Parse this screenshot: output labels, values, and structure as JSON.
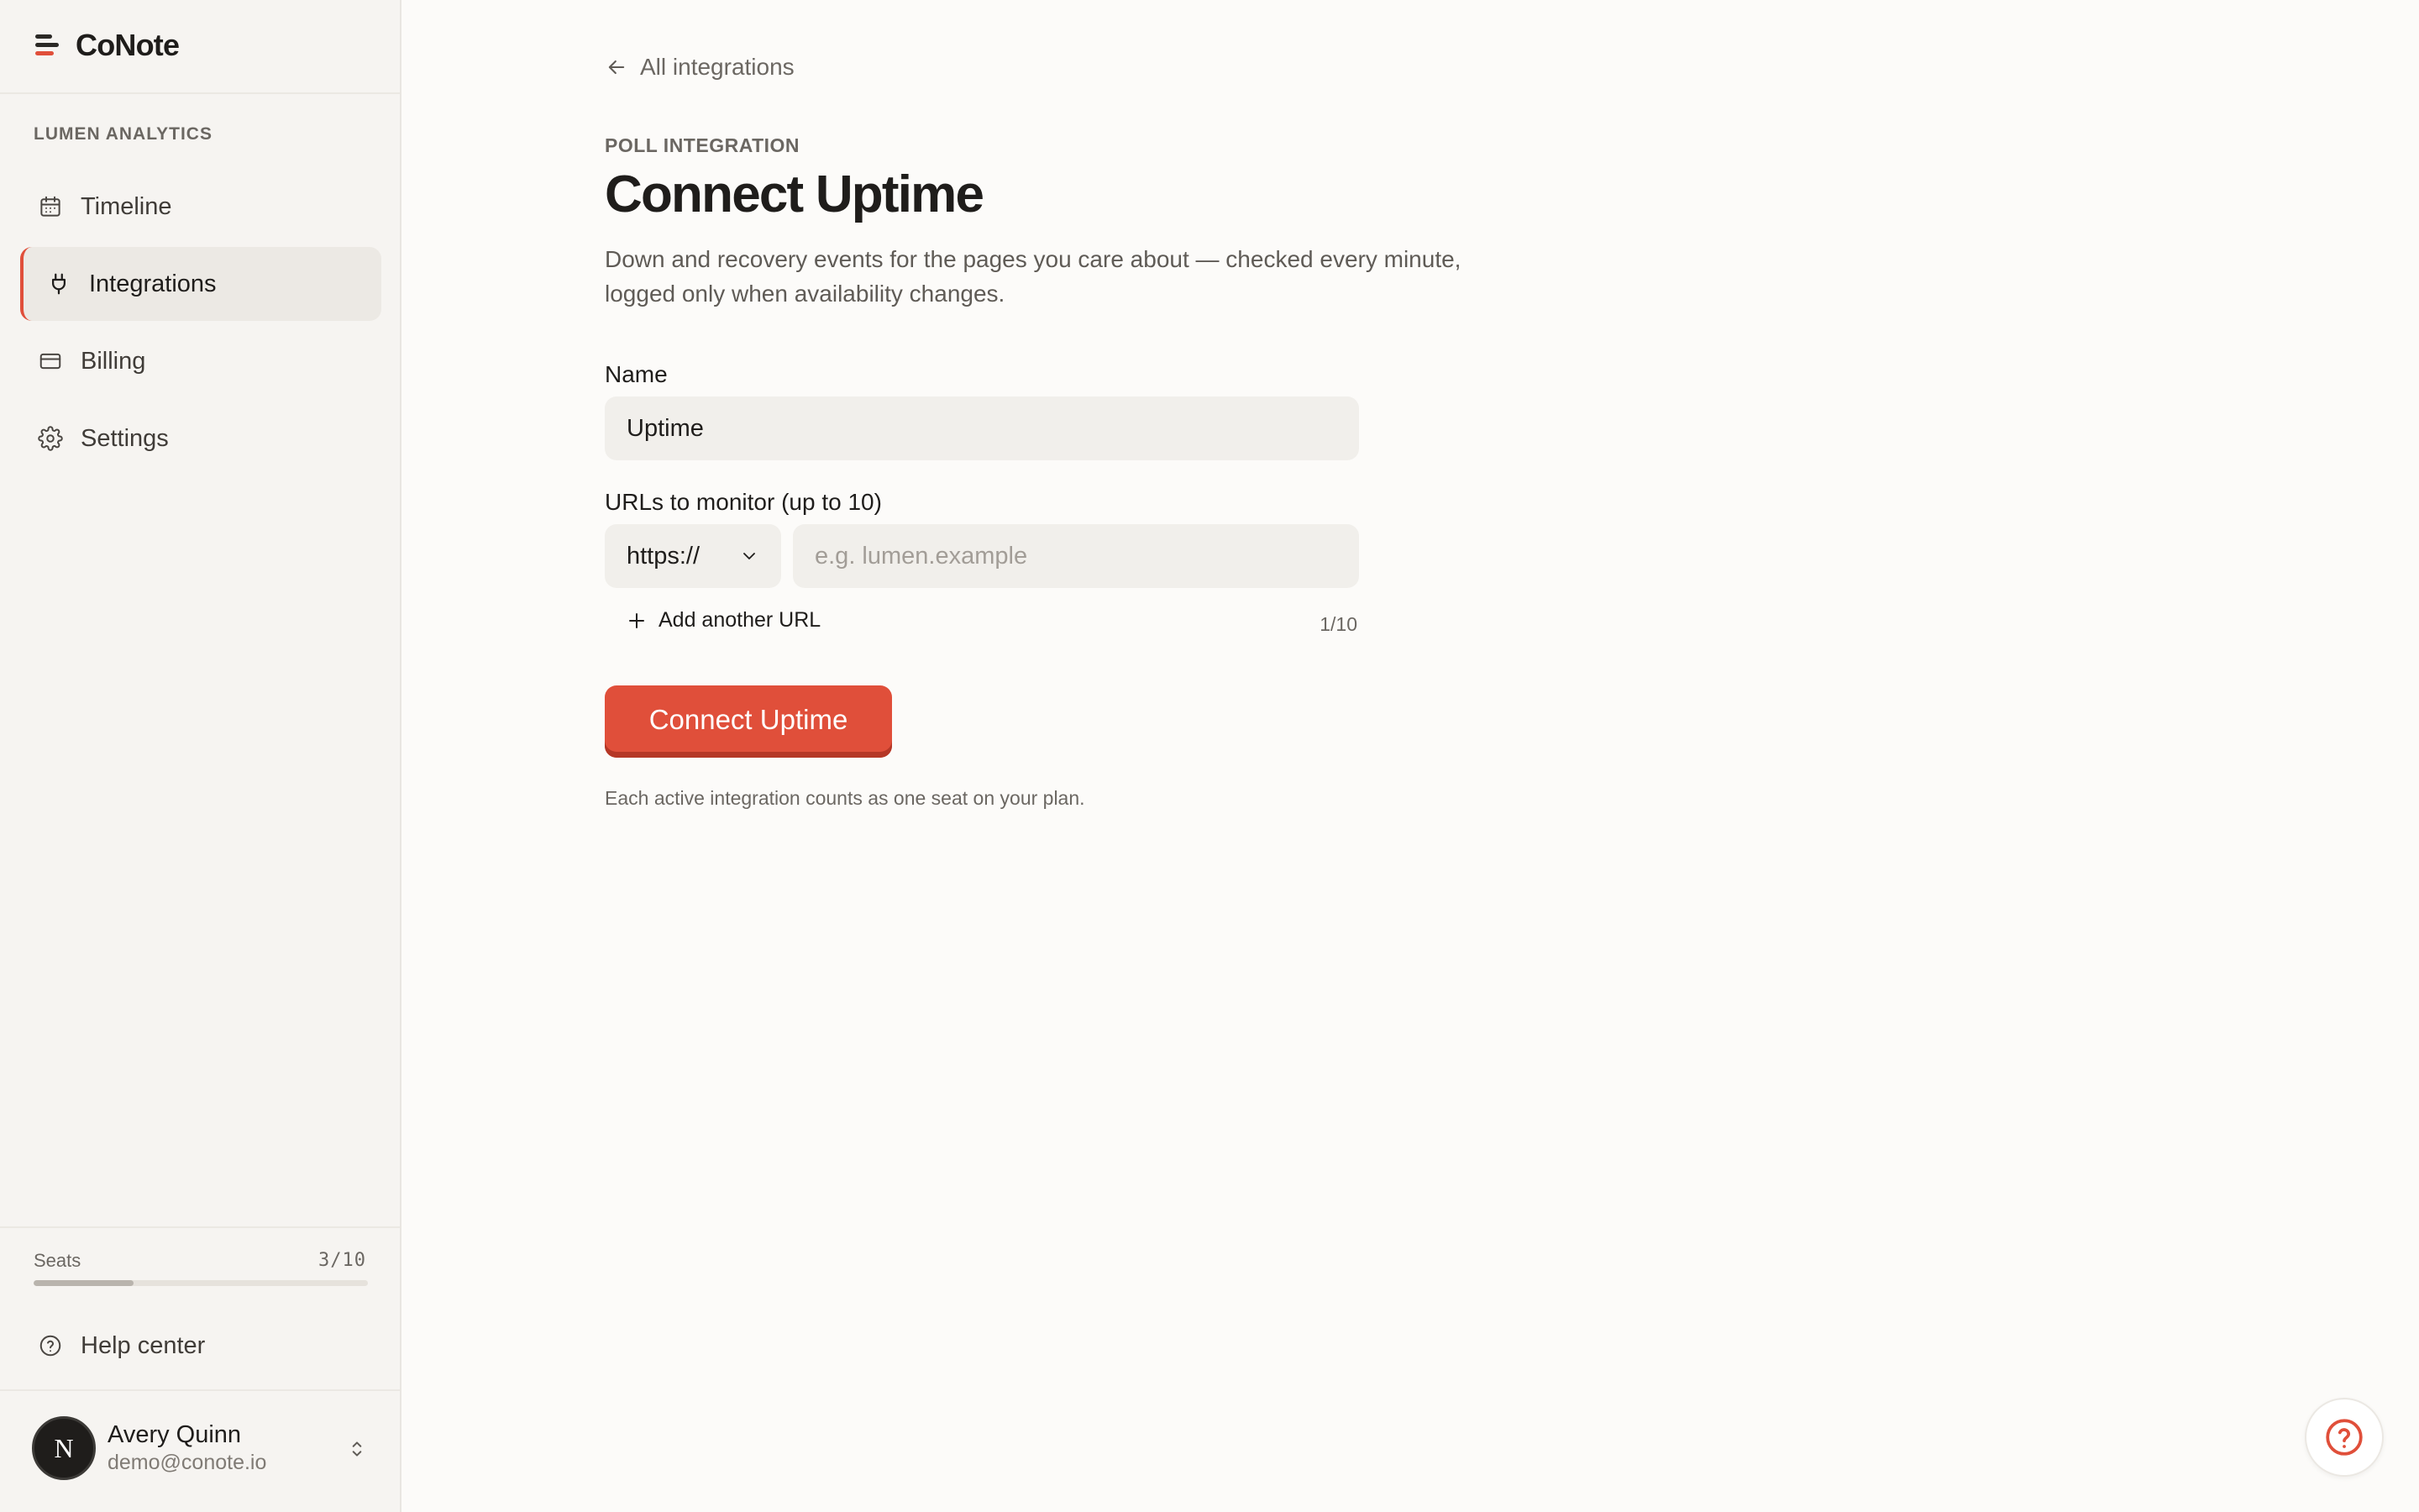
{
  "app": {
    "name": "CoNote",
    "accent_color": "#e04f3a"
  },
  "sidebar": {
    "workspace": "LUMEN ANALYTICS",
    "items": [
      {
        "label": "Timeline",
        "icon": "calendar-icon"
      },
      {
        "label": "Integrations",
        "icon": "plug-icon",
        "active": true
      },
      {
        "label": "Billing",
        "icon": "credit-card-icon"
      },
      {
        "label": "Settings",
        "icon": "gear-icon"
      }
    ],
    "seats": {
      "label": "Seats",
      "count": "3/10",
      "used_fraction": 0.3
    },
    "help": {
      "label": "Help center",
      "icon": "help-circle-icon"
    },
    "user": {
      "initial": "N",
      "name": "Avery Quinn",
      "email": "demo@conote.io"
    }
  },
  "main": {
    "back_label": "All integrations",
    "eyebrow": "POLL INTEGRATION",
    "title": "Connect Uptime",
    "description": "Down and recovery events for the pages you care about — checked every minute, logged only when availability changes.",
    "name_field": {
      "label": "Name",
      "value": "Uptime"
    },
    "urls_field": {
      "label": "URLs to monitor (up to 10)",
      "protocol": "https://",
      "placeholder": "e.g. lumen.example",
      "add_label": "Add another URL",
      "count": "1/10"
    },
    "submit_label": "Connect Uptime",
    "seat_note": "Each active integration counts as one seat on your plan."
  }
}
